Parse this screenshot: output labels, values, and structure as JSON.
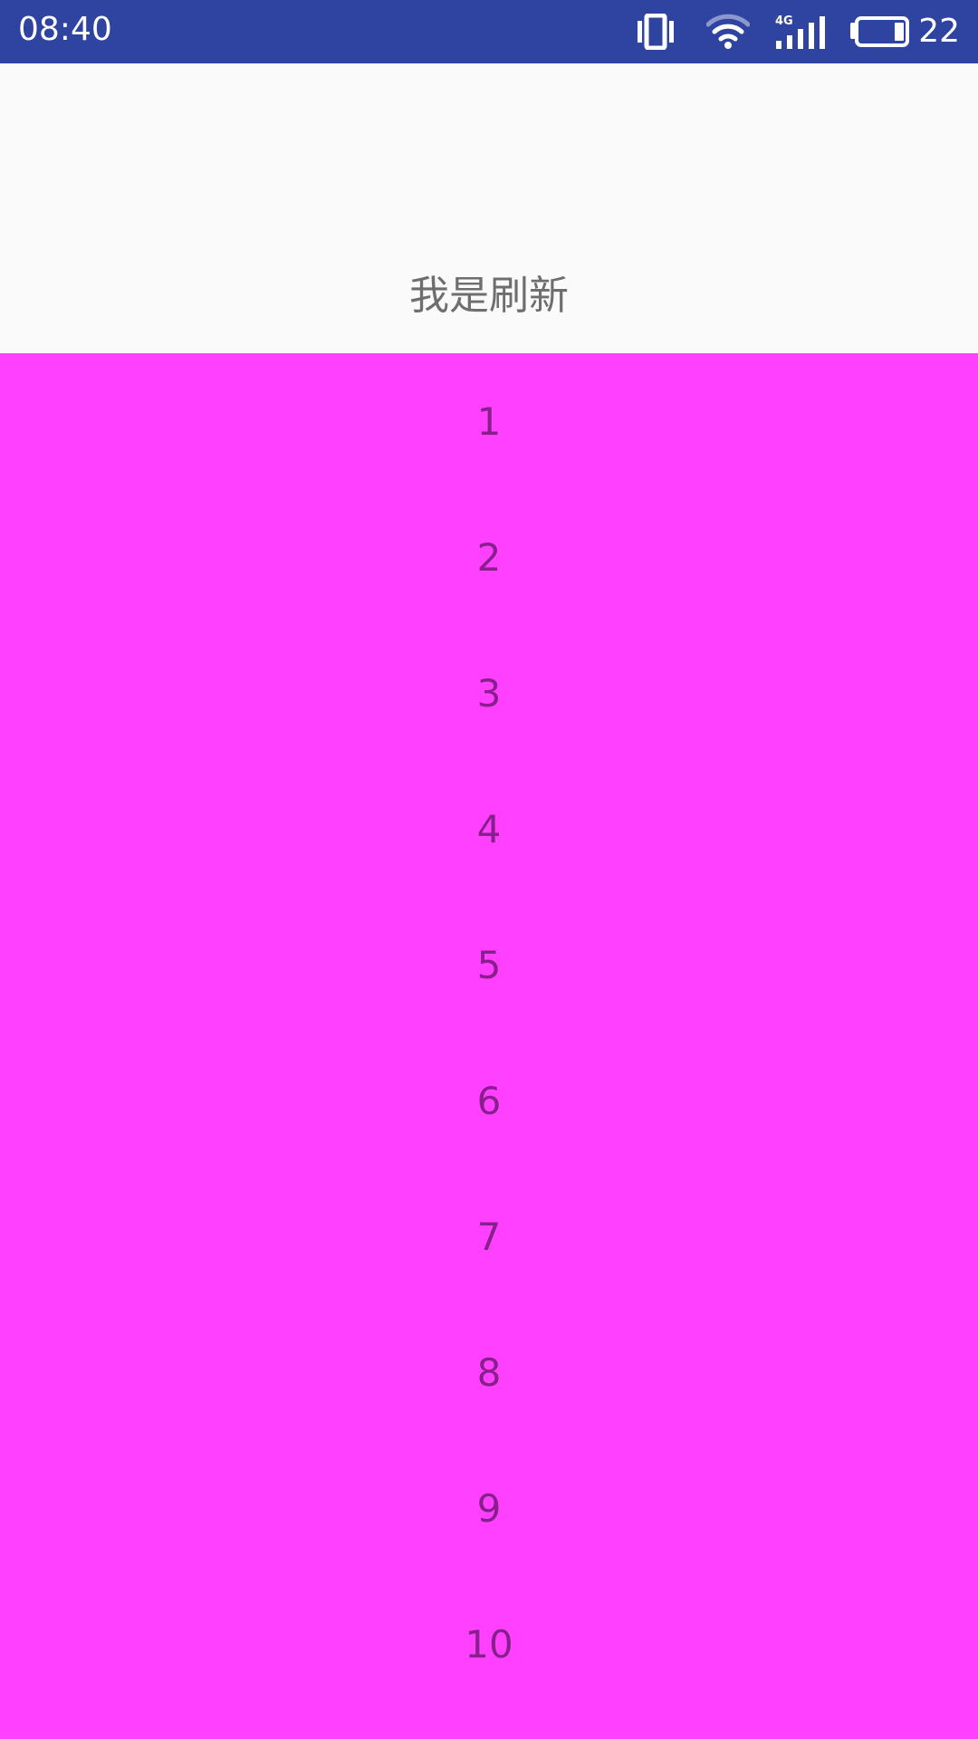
{
  "status_bar": {
    "time": "08:40",
    "battery_level": "22",
    "icons": [
      "vibrate-icon",
      "wifi-icon",
      "signal-4g-icon",
      "battery-icon"
    ],
    "network_label": "4G",
    "background_color": "#2f44a0"
  },
  "refresh_header": {
    "label": "我是刷新"
  },
  "list": {
    "background_color": "#ff40ff",
    "items": [
      "1",
      "2",
      "3",
      "4",
      "5",
      "6",
      "7",
      "8",
      "9",
      "10"
    ]
  }
}
